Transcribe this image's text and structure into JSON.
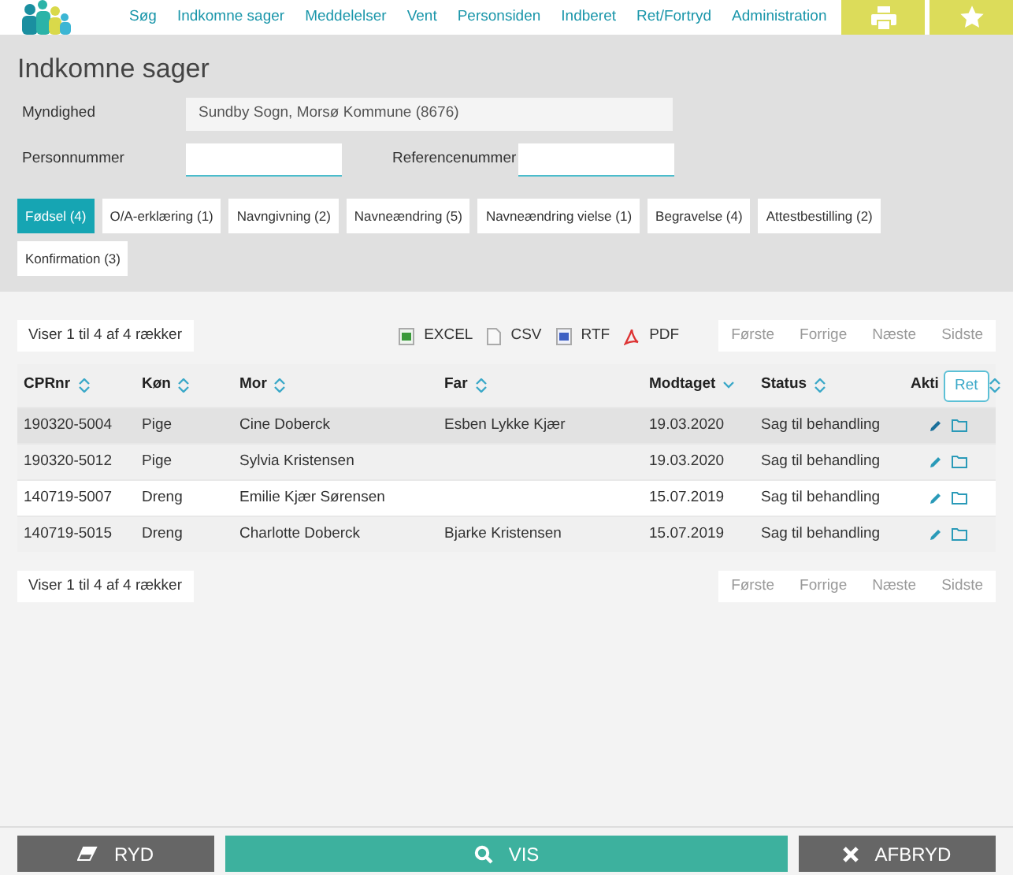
{
  "nav": {
    "items": [
      {
        "label": "Søg"
      },
      {
        "label": "Indkomne sager"
      },
      {
        "label": "Meddelelser"
      },
      {
        "label": "Vent"
      },
      {
        "label": "Personsiden"
      },
      {
        "label": "Indberet"
      },
      {
        "label": "Ret/Fortryd"
      },
      {
        "label": "Administration"
      }
    ],
    "actions": [
      {
        "kind": "print"
      },
      {
        "kind": "star"
      }
    ]
  },
  "page_title": "Indkomne sager",
  "form": {
    "authority_label": "Myndighed",
    "authority_value": "Sundby Sogn, Morsø Kommune (8676)",
    "person_label": "Personnummer",
    "reference_label": "Referencenummer"
  },
  "tabs": [
    {
      "label": "Fødsel (4)",
      "selected": true
    },
    {
      "label": "O/A-erklæring (1)",
      "selected": false
    },
    {
      "label": "Navngivning (2)",
      "selected": false
    },
    {
      "label": "Navneændring (5)",
      "selected": false
    },
    {
      "label": "Navneændring vielse (1)",
      "selected": false
    },
    {
      "label": "Begravelse (4)",
      "selected": false
    },
    {
      "label": "Attestbestilling (2)",
      "selected": false
    },
    {
      "label": "Konfirmation (3)",
      "selected": false
    }
  ],
  "info_top": "Viser 1 til 4 af 4 rækker",
  "exports": [
    {
      "kind": "excel",
      "label": "EXCEL"
    },
    {
      "kind": "csv",
      "label": "CSV"
    },
    {
      "kind": "rtf",
      "label": "RTF"
    },
    {
      "kind": "pdf",
      "label": "PDF"
    }
  ],
  "pager_top": [
    "Første",
    "Forrige",
    "Næste",
    "Sidste"
  ],
  "table": {
    "columns": [
      {
        "label": "CPRnr",
        "sorted": false
      },
      {
        "label": "Køn",
        "sorted": false
      },
      {
        "label": "Mor",
        "sorted": false
      },
      {
        "label": "Far",
        "sorted": false
      },
      {
        "label": "Modtaget",
        "sorted": true
      },
      {
        "label": "Status",
        "sorted": false
      },
      {
        "label": "Akti",
        "sorted": false
      }
    ],
    "tooltip": "Ret",
    "rows": [
      {
        "cells": [
          "190320-5004",
          "Pige",
          "Cine Doberck",
          "Esben Lykke Kjær",
          "19.03.2020",
          "Sag til behandling"
        ],
        "highlighted": true
      },
      {
        "cells": [
          "190320-5012",
          "Pige",
          "Sylvia Kristensen",
          "",
          "19.03.2020",
          "Sag til behandling"
        ],
        "highlighted": false
      },
      {
        "cells": [
          "140719-5007",
          "Dreng",
          "Emilie Kjær Sørensen",
          "",
          "15.07.2019",
          "Sag til behandling"
        ],
        "highlighted": false
      },
      {
        "cells": [
          "140719-5015",
          "Dreng",
          "Charlotte Doberck",
          "Bjarke Kristensen",
          "15.07.2019",
          "Sag til behandling"
        ],
        "highlighted": false
      }
    ]
  },
  "info_bottom": "Viser 1 til 4 af 4 rækker",
  "pager_bottom": [
    "Første",
    "Forrige",
    "Næste",
    "Sidste"
  ],
  "footer_buttons": [
    {
      "kind": "clear",
      "label": "RYD"
    },
    {
      "kind": "show",
      "label": "VIS"
    },
    {
      "kind": "cancel",
      "label": "AFBRYD"
    }
  ]
}
